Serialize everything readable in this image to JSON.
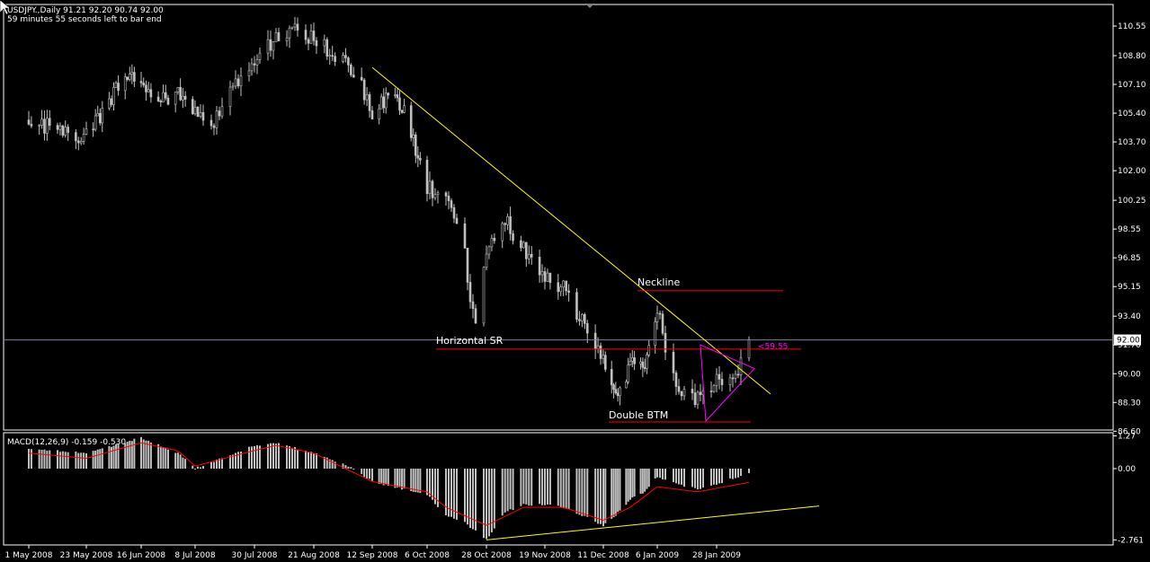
{
  "header": {
    "title": "USDJPY.,Daily  91.21 92.20 90.74 92.00",
    "countdown": "59 minutes 55 seconds left to bar end"
  },
  "colors": {
    "background": "#000000",
    "grid_border": "#ffffff",
    "candle": "#c0c0c0",
    "trendline": "#ffff00",
    "support": "#ff0000",
    "triangle": "#ff00ff",
    "price_line": "#8080a0",
    "macd_signal": "#ff0000",
    "price_label_bg": "#ffffff"
  },
  "chart_data": [
    {
      "type": "candlestick",
      "title": "USDJPY.,Daily",
      "ohlc_last": {
        "open": 91.21,
        "high": 92.2,
        "low": 90.74,
        "close": 92.0
      },
      "y_ticks": [
        "110.55",
        "108.80",
        "107.10",
        "105.40",
        "103.70",
        "102.00",
        "100.25",
        "98.55",
        "96.85",
        "95.15",
        "93.40",
        "91.70",
        "90.00",
        "88.30",
        "86.60"
      ],
      "ylim": [
        86.3,
        111.5
      ],
      "current_price_label": "92.00",
      "x_ticks": [
        "1 May 2008",
        "23 May 2008",
        "16 Jun 2008",
        "8 Jul 2008",
        "30 Jul 2008",
        "21 Aug 2008",
        "12 Sep 2008",
        "6 Oct 2008",
        "28 Oct 2008",
        "19 Nov 2008",
        "11 Dec 2008",
        "6 Jan 2009",
        "28 Jan 2009"
      ],
      "close_path": [
        [
          "1 May 2008",
          105.0
        ],
        [
          "10 May 2008",
          104.5
        ],
        [
          "23 May 2008",
          104.0
        ],
        [
          "2 Jun 2008",
          106.0
        ],
        [
          "9 Jun 2008",
          107.8
        ],
        [
          "16 Jun 2008",
          107.5
        ],
        [
          "23 Jun 2008",
          106.0
        ],
        [
          "1 Jul 2008",
          106.5
        ],
        [
          "8 Jul 2008",
          105.5
        ],
        [
          "15 Jul 2008",
          105.0
        ],
        [
          "22 Jul 2008",
          107.0
        ],
        [
          "30 Jul 2008",
          108.0
        ],
        [
          "7 Aug 2008",
          110.0
        ],
        [
          "14 Aug 2008",
          110.3
        ],
        [
          "21 Aug 2008",
          109.8
        ],
        [
          "28 Aug 2008",
          109.0
        ],
        [
          "5 Sep 2008",
          108.0
        ],
        [
          "12 Sep 2008",
          105.5
        ],
        [
          "19 Sep 2008",
          106.5
        ],
        [
          "26 Sep 2008",
          105.5
        ],
        [
          "6 Oct 2008",
          101.0
        ],
        [
          "13 Oct 2008",
          100.5
        ],
        [
          "20 Oct 2008",
          97.0
        ],
        [
          "24 Oct 2008",
          92.5
        ],
        [
          "28 Oct 2008",
          97.5
        ],
        [
          "4 Nov 2008",
          99.0
        ],
        [
          "11 Nov 2008",
          97.5
        ],
        [
          "19 Nov 2008",
          95.8
        ],
        [
          "26 Nov 2008",
          95.0
        ],
        [
          "3 Dec 2008",
          93.0
        ],
        [
          "11 Dec 2008",
          91.0
        ],
        [
          "17 Dec 2008",
          88.5
        ],
        [
          "24 Dec 2008",
          90.5
        ],
        [
          "31 Dec 2008",
          90.8
        ],
        [
          "6 Jan 2009",
          93.8
        ],
        [
          "13 Jan 2009",
          89.0
        ],
        [
          "21 Jan 2009",
          88.5
        ],
        [
          "28 Jan 2009",
          89.5
        ],
        [
          "5 Feb 2009",
          90.0
        ],
        [
          "9 Feb 2009",
          92.0
        ]
      ],
      "annotations": {
        "neckline": {
          "label": "Neckline",
          "price": 94.9
        },
        "horizontal_sr": {
          "label": "Horizontal SR",
          "price": 91.45
        },
        "double_btm": {
          "label": "Double BTM",
          "price": 87.15
        },
        "pattern_label": "<59.55",
        "trendline": {
          "from": [
            "12 Sep 2008",
            108.1
          ],
          "to": [
            "17 Feb 2009",
            88.8
          ]
        },
        "triangle": [
          [
            "22 Jan 2009",
            91.7
          ],
          [
            "11 Feb 2009",
            90.3
          ],
          [
            "24 Jan 2009",
            87.2
          ]
        ]
      }
    },
    {
      "type": "bar",
      "title": "MACD(12,26,9) -0.159 -0.530",
      "y_ticks": [
        "1.27",
        "0.00",
        "-2.761"
      ],
      "ylim": [
        -2.761,
        1.27
      ],
      "histogram_path": [
        [
          "1 May 2008",
          0.8
        ],
        [
          "23 May 2008",
          0.6
        ],
        [
          "8 Jun 2008",
          1.0
        ],
        [
          "16 Jun 2008",
          1.2
        ],
        [
          "1 Jul 2008",
          0.6
        ],
        [
          "8 Jul 2008",
          0.0
        ],
        [
          "20 Jul 2008",
          0.5
        ],
        [
          "30 Jul 2008",
          0.9
        ],
        [
          "7 Aug 2008",
          1.0
        ],
        [
          "21 Aug 2008",
          0.6
        ],
        [
          "5 Sep 2008",
          0.0
        ],
        [
          "12 Sep 2008",
          -0.5
        ],
        [
          "26 Sep 2008",
          -0.8
        ],
        [
          "6 Oct 2008",
          -1.0
        ],
        [
          "13 Oct 2008",
          -1.8
        ],
        [
          "20 Oct 2008",
          -2.1
        ],
        [
          "28 Oct 2008",
          -2.76
        ],
        [
          "4 Nov 2008",
          -1.7
        ],
        [
          "11 Nov 2008",
          -1.4
        ],
        [
          "19 Nov 2008",
          -1.4
        ],
        [
          "26 Nov 2008",
          -1.5
        ],
        [
          "3 Dec 2008",
          -1.8
        ],
        [
          "11 Dec 2008",
          -2.2
        ],
        [
          "17 Dec 2008",
          -1.8
        ],
        [
          "24 Dec 2008",
          -1.2
        ],
        [
          "31 Dec 2008",
          -0.9
        ],
        [
          "6 Jan 2009",
          -0.3
        ],
        [
          "13 Jan 2009",
          -0.6
        ],
        [
          "21 Jan 2009",
          -0.8
        ],
        [
          "28 Jan 2009",
          -0.6
        ],
        [
          "9 Feb 2009",
          -0.16
        ]
      ],
      "signal_path": [
        [
          "1 May 2008",
          0.6
        ],
        [
          "23 May 2008",
          0.4
        ],
        [
          "16 Jun 2008",
          1.0
        ],
        [
          "1 Jul 2008",
          0.7
        ],
        [
          "8 Jul 2008",
          0.1
        ],
        [
          "30 Jul 2008",
          0.7
        ],
        [
          "7 Aug 2008",
          0.9
        ],
        [
          "21 Aug 2008",
          0.6
        ],
        [
          "12 Sep 2008",
          -0.5
        ],
        [
          "6 Oct 2008",
          -0.9
        ],
        [
          "13 Oct 2008",
          -1.5
        ],
        [
          "28 Oct 2008",
          -2.2
        ],
        [
          "11 Nov 2008",
          -1.5
        ],
        [
          "26 Nov 2008",
          -1.5
        ],
        [
          "11 Dec 2008",
          -2.0
        ],
        [
          "24 Dec 2008",
          -1.5
        ],
        [
          "6 Jan 2009",
          -0.7
        ],
        [
          "21 Jan 2009",
          -0.9
        ],
        [
          "9 Feb 2009",
          -0.53
        ]
      ],
      "trendline": {
        "from": [
          "28 Oct 2008",
          -2.76
        ],
        "to": [
          "7 Mar 2009",
          -1.45
        ]
      }
    }
  ]
}
